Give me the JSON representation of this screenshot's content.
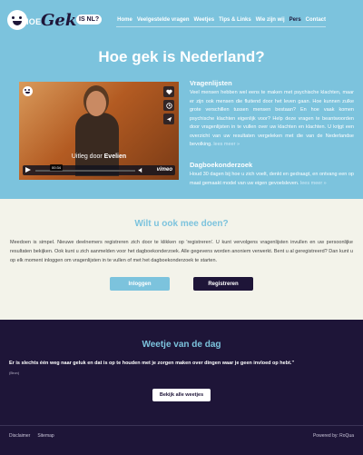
{
  "logo": {
    "hoe": "HOE",
    "gek": "Gek",
    "isnl": "IS NL?"
  },
  "nav": {
    "items": [
      {
        "label": "Home"
      },
      {
        "label": "Veelgestelde vragen"
      },
      {
        "label": "Weetjes"
      },
      {
        "label": "Tips & Links"
      },
      {
        "label": "Wie zijn wij"
      },
      {
        "label": "Pers"
      },
      {
        "label": "Contact"
      }
    ],
    "active": "Pers"
  },
  "hero": {
    "title": "Hoe gek is Nederland?"
  },
  "video": {
    "caption_prefix": "Uitleg door ",
    "caption_name": "Evelien",
    "time": "00:34",
    "brand": "vimeo",
    "icons": [
      "heart-icon",
      "clock-icon",
      "send-icon"
    ]
  },
  "sections": [
    {
      "title": "Vragenlijsten",
      "text": "Veel mensen hebben wel eens te maken met psychische klachten, maar er zijn ook mensen die fluitend door het leven gaan. Hoe kunnen zulke grote verschillen tussen mensen bestaan? En hoe vaak komen psychische klachten eigenlijk voor? Help deze vragen te beantwoorden door vragenlijsten in te vullen over uw klachten en klachten. U krijgt een overzicht van uw resultaten vergeleken met die van de Nederlandse bevolking.",
      "more": "lees meer »"
    },
    {
      "title": "Dagboekonderzoek",
      "text": "Houd 30 dagen bij hoe u zich voelt, denkt en gedraagt, en ontvang een op maat gemaakt model van uw eigen gevoelsleven.",
      "more": "lees meer »"
    }
  ],
  "join": {
    "title": "Wilt u ook mee doen?",
    "text": "Meedoen is simpel. Nieuwe deelnemers registreren zich door te klikken op 'registreren'. U kunt vervolgens vragenlijsten invullen en uw persoonlijke resultaten bekijken. Ook kunt u zich aanmelden voor het dagboekonderzoek. Alle gegevens worden anoniem verwerkt. Bent u al geregistreerd? Dan kunt u op elk moment inloggen om vragenlijsten in te vullen of met het dagboekonderzoek te starten.",
    "login_label": "Inloggen",
    "register_label": "Registreren"
  },
  "daily": {
    "title": "Weetje van de dag",
    "quote": "Er is slechts één weg naar geluk en dat is op te houden met je zorgen maken over dingen waar je geen invloed op hebt.\"",
    "source": "(Bron)",
    "button_label": "Bekijk alle weetjes"
  },
  "footer": {
    "links": [
      "Disclaimer",
      "Sitemap"
    ],
    "credit": "Powered by: RoQua"
  },
  "colors": {
    "hero_blue": "#7cc3dd",
    "dark_navy": "#1e1538",
    "cream": "#f3f3ea"
  }
}
